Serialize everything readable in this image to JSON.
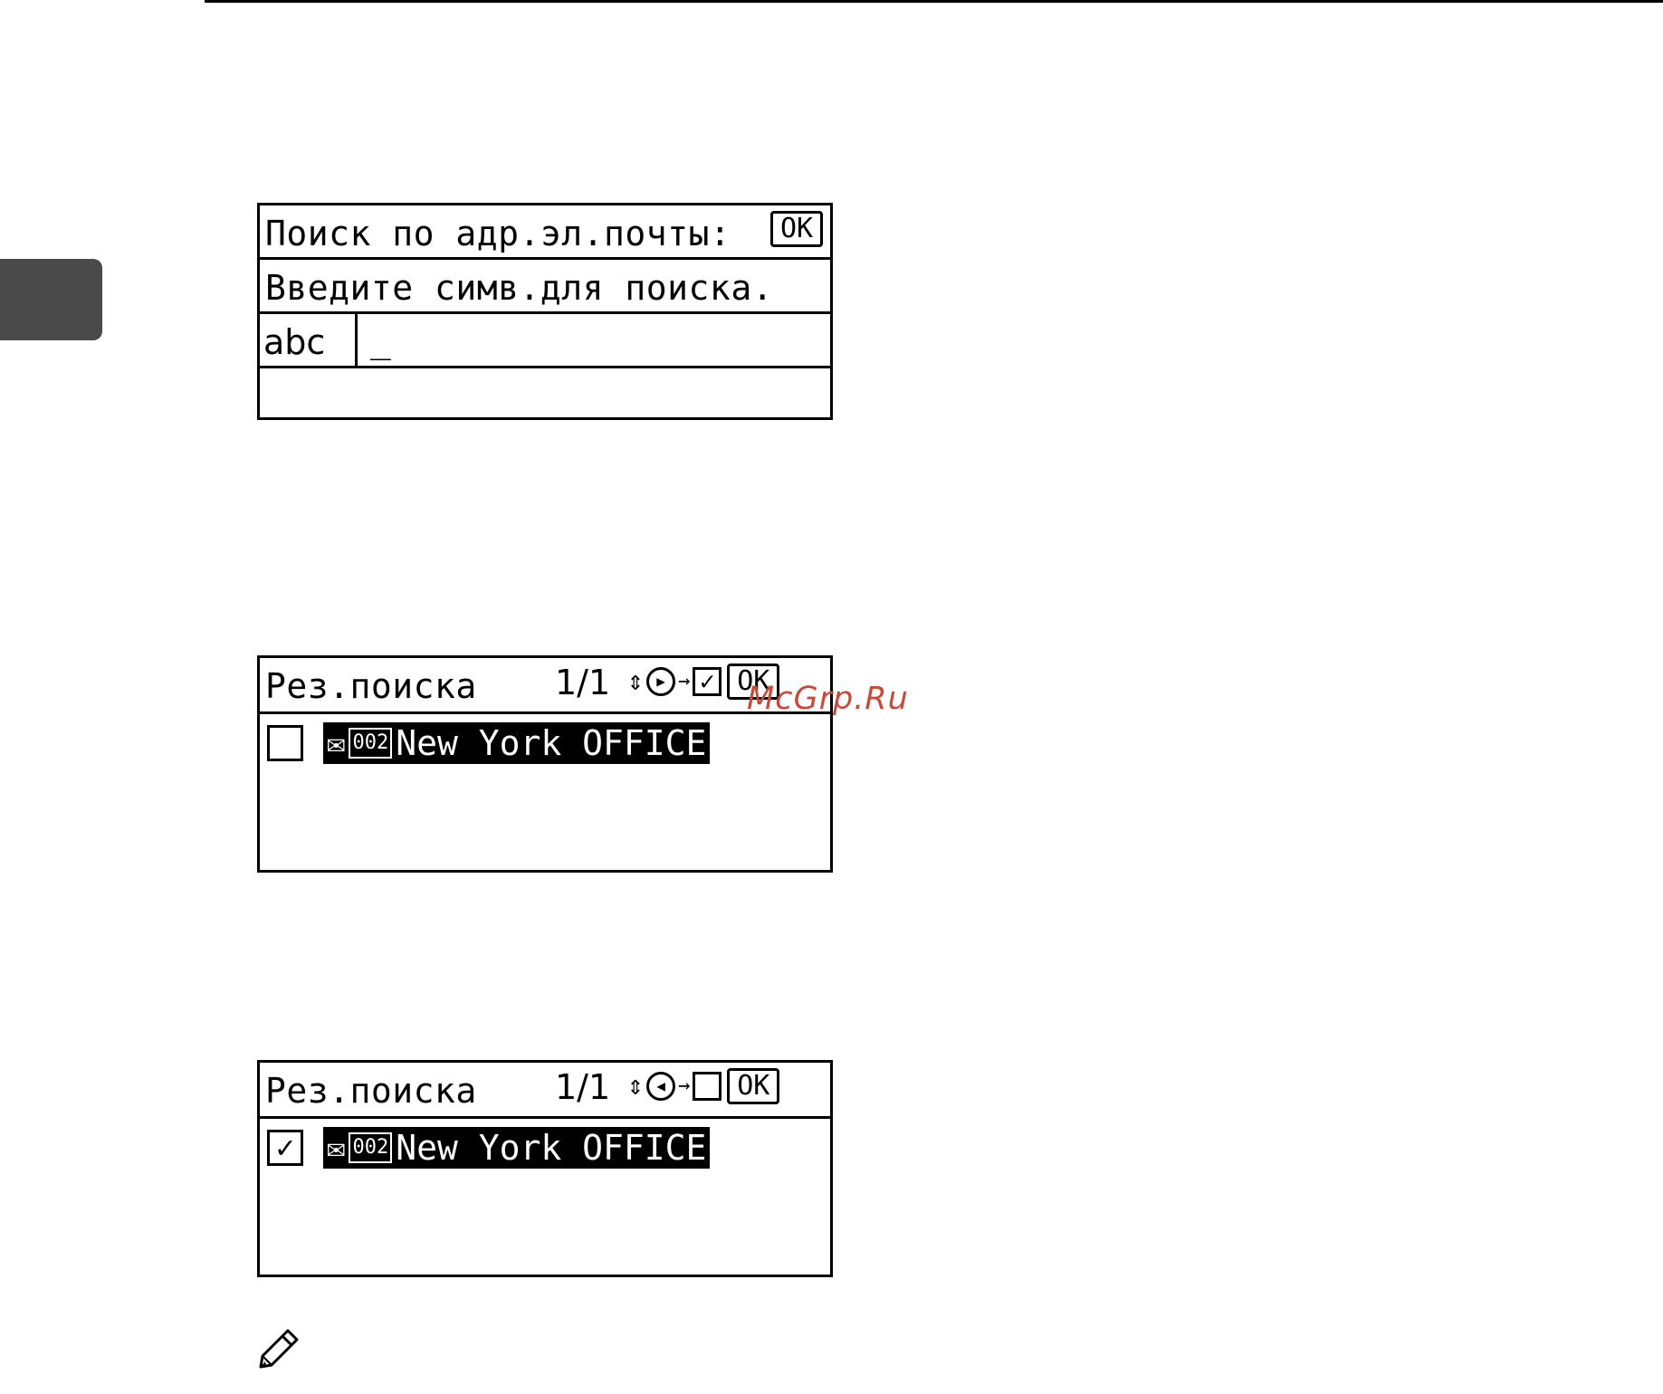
{
  "colors": {
    "ink": "#000000",
    "side_tab": "#4a4a4a",
    "watermark": "#c84a3a"
  },
  "screen1": {
    "title": "Поиск по адр.эл.почты:",
    "ok_label": "OK",
    "prompt": "Введите симв.для поиска.",
    "input_mode": "abc",
    "cursor": "_"
  },
  "screen2": {
    "title": "Рез.поиска",
    "page": "1/1",
    "ok_label": "OK",
    "select_icon": "right-circle-arrow",
    "target_state": "checked",
    "entry": {
      "checked": false,
      "type_icon": "email-icon",
      "number": "002",
      "name": "New York OFFICE"
    }
  },
  "screen3": {
    "title": "Рез.поиска",
    "page": "1/1",
    "ok_label": "OK",
    "select_icon": "left-circle-arrow",
    "target_state": "unchecked",
    "entry": {
      "checked": true,
      "type_icon": "email-icon",
      "number": "002",
      "name": "New York OFFICE"
    }
  },
  "watermark": "McGrp.Ru",
  "note_icon": "pencil-icon"
}
